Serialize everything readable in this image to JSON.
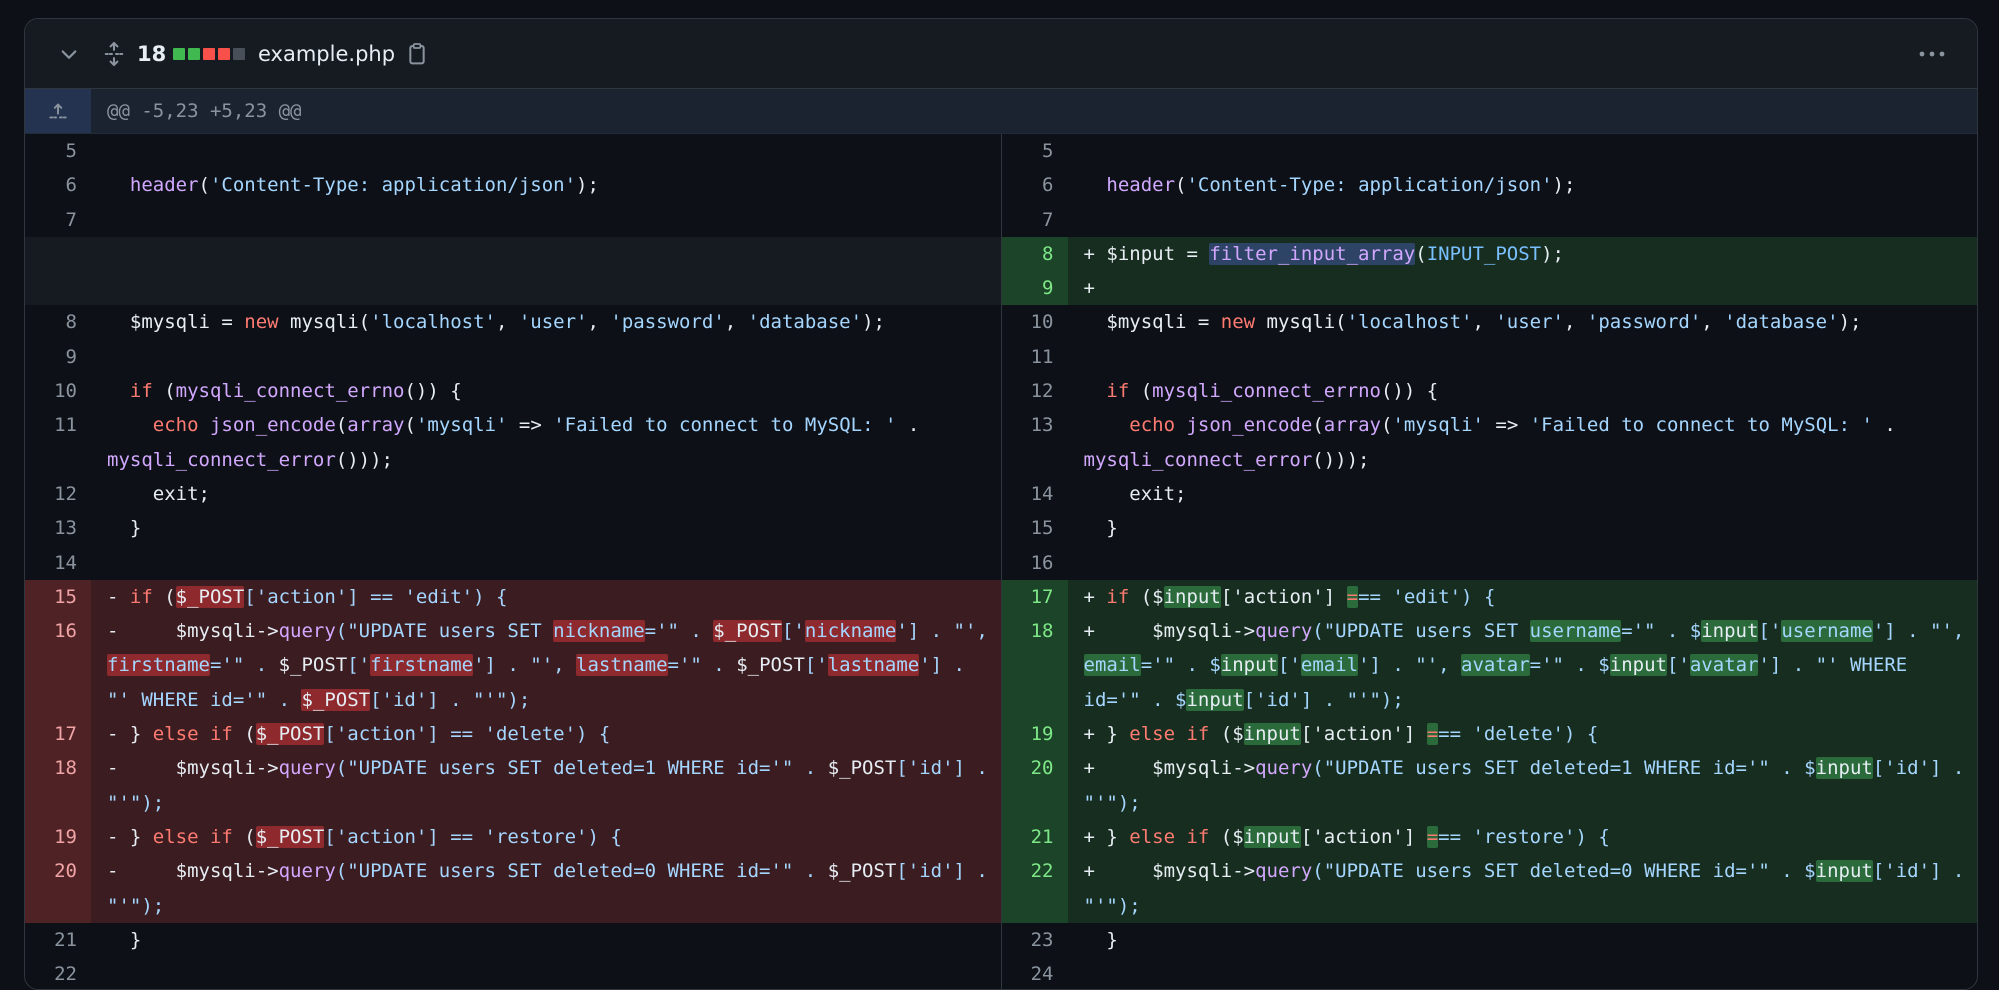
{
  "file": {
    "changes": "18",
    "name": "example.php",
    "stat_blocks": [
      "#3fb950",
      "#3fb950",
      "#f85149",
      "#f85149",
      "#484f58"
    ],
    "icons": {
      "collapse": "chevron-down-icon",
      "expand": "unfold-icon",
      "copy": "copy-icon",
      "menu": "kebab-horizontal-icon"
    }
  },
  "hunk": {
    "header": "@@ -5,23 +5,23 @@",
    "icon": "expand-up-icon"
  },
  "left_rows": [
    {
      "n": "5",
      "t": "ctx",
      "tok": []
    },
    {
      "n": "6",
      "t": "ctx",
      "tok": [
        [
          "  "
        ],
        [
          "header",
          "fn"
        ],
        [
          "("
        ],
        [
          "'Content-Type: application/json'",
          "str"
        ],
        [
          ");"
        ]
      ]
    },
    {
      "n": "7",
      "t": "ctx",
      "tok": []
    },
    {
      "n": "",
      "t": "empty",
      "tok": []
    },
    {
      "n": "",
      "t": "empty",
      "tok": []
    },
    {
      "n": "8",
      "t": "ctx",
      "tok": [
        [
          "  $mysqli = "
        ],
        [
          "new",
          "kw"
        ],
        [
          " mysqli("
        ],
        [
          "'localhost'",
          "str"
        ],
        [
          ", "
        ],
        [
          "'user'",
          "str"
        ],
        [
          ", "
        ],
        [
          "'password'",
          "str"
        ],
        [
          ", "
        ],
        [
          "'database'",
          "str"
        ],
        [
          ");"
        ]
      ]
    },
    {
      "n": "9",
      "t": "ctx",
      "tok": []
    },
    {
      "n": "10",
      "t": "ctx",
      "tok": [
        [
          "  "
        ],
        [
          "if",
          "kw"
        ],
        [
          " ("
        ],
        [
          "mysqli_connect_errno",
          "fn"
        ],
        [
          "()) {"
        ]
      ]
    },
    {
      "n": "11",
      "t": "ctx",
      "tok": [
        [
          "    "
        ],
        [
          "echo",
          "kw"
        ],
        [
          " "
        ],
        [
          "json_encode",
          "fn"
        ],
        [
          "("
        ],
        [
          "array",
          "fn"
        ],
        [
          "("
        ],
        [
          "'mysqli'",
          "str"
        ],
        [
          " => "
        ],
        [
          "'Failed to connect to MySQL: '",
          "str"
        ],
        [
          " . "
        ],
        [
          "mysqli_connect_error",
          "fn"
        ],
        [
          "()));"
        ]
      ]
    },
    {
      "n": "12",
      "t": "ctx",
      "tok": [
        [
          "    exit;"
        ]
      ]
    },
    {
      "n": "13",
      "t": "ctx",
      "tok": [
        [
          "  }"
        ]
      ]
    },
    {
      "n": "14",
      "t": "ctx",
      "tok": []
    },
    {
      "n": "15",
      "t": "del",
      "tok": [
        [
          "- "
        ],
        [
          "if",
          "kw"
        ],
        [
          " ("
        ],
        [
          "$_POST",
          "var",
          "hd"
        ],
        [
          "['action'] == 'edit') {",
          "str"
        ]
      ]
    },
    {
      "n": "16",
      "t": "del",
      "tok": [
        [
          "-     $mysqli->"
        ],
        [
          "query",
          "fn"
        ],
        [
          "(\"UPDATE users SET ",
          "str"
        ],
        [
          "nickname",
          "str",
          "hd"
        ],
        [
          "='\" . ",
          "str"
        ],
        [
          "$_POST",
          "var",
          "hd"
        ],
        [
          "['",
          "str"
        ],
        [
          "nickname",
          "str",
          "hd"
        ],
        [
          "'] . \"', ",
          "str"
        ],
        [
          "firstname",
          "str",
          "hd"
        ],
        [
          "='\" . ",
          "str"
        ],
        [
          "$_POST",
          "var"
        ],
        [
          "['",
          "str"
        ],
        [
          "firstname",
          "str",
          "hd"
        ],
        [
          "'] . \"', ",
          "str"
        ],
        [
          "lastname",
          "str",
          "hd"
        ],
        [
          "='\" . ",
          "str"
        ],
        [
          "$_POST",
          "var"
        ],
        [
          "['",
          "str"
        ],
        [
          "lastname",
          "str",
          "hd"
        ],
        [
          "'] . \"' WHERE id='\" . ",
          "str"
        ],
        [
          "$_POST",
          "var",
          "hd"
        ],
        [
          "['id'] . \"'\");",
          "str"
        ]
      ]
    },
    {
      "n": "17",
      "t": "del",
      "tok": [
        [
          "- } "
        ],
        [
          "else if",
          "kw"
        ],
        [
          " ("
        ],
        [
          "$_POST",
          "var",
          "hd"
        ],
        [
          "['action'] == 'delete') {",
          "str"
        ]
      ]
    },
    {
      "n": "18",
      "t": "del",
      "tok": [
        [
          "-     $mysqli->"
        ],
        [
          "query",
          "fn"
        ],
        [
          "(\"UPDATE users SET deleted=1 WHERE id='\" . ",
          "str"
        ],
        [
          "$_POST",
          "var"
        ],
        [
          "['id'] . \"'\");",
          "str"
        ]
      ]
    },
    {
      "n": "19",
      "t": "del",
      "tok": [
        [
          "- } "
        ],
        [
          "else if",
          "kw"
        ],
        [
          " ("
        ],
        [
          "$_POST",
          "var",
          "hd"
        ],
        [
          "['action'] == 'restore') {",
          "str"
        ]
      ]
    },
    {
      "n": "20",
      "t": "del",
      "tok": [
        [
          "-     $mysqli->"
        ],
        [
          "query",
          "fn"
        ],
        [
          "(\"UPDATE users SET deleted=0 WHERE id='\" . ",
          "str"
        ],
        [
          "$_POST",
          "var"
        ],
        [
          "['id'] . \"'\");",
          "str"
        ]
      ]
    },
    {
      "n": "21",
      "t": "ctx",
      "tok": [
        [
          "  }"
        ]
      ]
    },
    {
      "n": "22",
      "t": "ctx",
      "tok": []
    }
  ],
  "right_rows": [
    {
      "n": "5",
      "t": "ctx",
      "tok": []
    },
    {
      "n": "6",
      "t": "ctx",
      "tok": [
        [
          "  "
        ],
        [
          "header",
          "fn"
        ],
        [
          "("
        ],
        [
          "'Content-Type: application/json'",
          "str"
        ],
        [
          ");"
        ]
      ]
    },
    {
      "n": "7",
      "t": "ctx",
      "tok": []
    },
    {
      "n": "8",
      "t": "add",
      "tok": [
        [
          "+ $input = "
        ],
        [
          "filter_input_array",
          "fn",
          "hs"
        ],
        [
          "("
        ],
        [
          "INPUT_POST",
          "cst"
        ],
        [
          ");"
        ]
      ]
    },
    {
      "n": "9",
      "t": "add",
      "tok": [
        [
          "+"
        ]
      ]
    },
    {
      "n": "10",
      "t": "ctx",
      "tok": [
        [
          "  $mysqli = "
        ],
        [
          "new",
          "kw"
        ],
        [
          " mysqli("
        ],
        [
          "'localhost'",
          "str"
        ],
        [
          ", "
        ],
        [
          "'user'",
          "str"
        ],
        [
          ", "
        ],
        [
          "'password'",
          "str"
        ],
        [
          ", "
        ],
        [
          "'database'",
          "str"
        ],
        [
          ");"
        ]
      ]
    },
    {
      "n": "11",
      "t": "ctx",
      "tok": []
    },
    {
      "n": "12",
      "t": "ctx",
      "tok": [
        [
          "  "
        ],
        [
          "if",
          "kw"
        ],
        [
          " ("
        ],
        [
          "mysqli_connect_errno",
          "fn"
        ],
        [
          "()) {"
        ]
      ]
    },
    {
      "n": "13",
      "t": "ctx",
      "tok": [
        [
          "    "
        ],
        [
          "echo",
          "kw"
        ],
        [
          " "
        ],
        [
          "json_encode",
          "fn"
        ],
        [
          "("
        ],
        [
          "array",
          "fn"
        ],
        [
          "("
        ],
        [
          "'mysqli'",
          "str"
        ],
        [
          " => "
        ],
        [
          "'Failed to connect to MySQL: '",
          "str"
        ],
        [
          " . "
        ],
        [
          "mysqli_connect_error",
          "fn"
        ],
        [
          "()));"
        ]
      ]
    },
    {
      "n": "14",
      "t": "ctx",
      "tok": [
        [
          "    exit;"
        ]
      ]
    },
    {
      "n": "15",
      "t": "ctx",
      "tok": [
        [
          "  }"
        ]
      ]
    },
    {
      "n": "16",
      "t": "ctx",
      "tok": []
    },
    {
      "n": "17",
      "t": "add",
      "tok": [
        [
          "+ "
        ],
        [
          "if",
          "kw"
        ],
        [
          " ($"
        ],
        [
          "input",
          "var",
          "ha"
        ],
        [
          "['action'] "
        ],
        [
          "=",
          "kw",
          "ha"
        ],
        [
          "== 'edit') {",
          "str"
        ]
      ]
    },
    {
      "n": "18",
      "t": "add",
      "tok": [
        [
          "+     $mysqli->"
        ],
        [
          "query",
          "fn"
        ],
        [
          "(\"UPDATE users SET ",
          "str"
        ],
        [
          "username",
          "str",
          "ha"
        ],
        [
          "='\" . $",
          "str"
        ],
        [
          "input",
          "var",
          "ha"
        ],
        [
          "['",
          "str"
        ],
        [
          "username",
          "str",
          "ha"
        ],
        [
          "'] . \"', ",
          "str"
        ],
        [
          "email",
          "str",
          "ha"
        ],
        [
          "='\" . $",
          "str"
        ],
        [
          "input",
          "var",
          "ha"
        ],
        [
          "['",
          "str"
        ],
        [
          "email",
          "str",
          "ha"
        ],
        [
          "'] . \"', ",
          "str"
        ],
        [
          "avatar",
          "str",
          "ha"
        ],
        [
          "='\" . $",
          "str"
        ],
        [
          "input",
          "var",
          "ha"
        ],
        [
          "['",
          "str"
        ],
        [
          "avatar",
          "str",
          "ha"
        ],
        [
          "'] . \"' WHERE id='\" . $",
          "str"
        ],
        [
          "input",
          "var",
          "ha"
        ],
        [
          "['id'] . \"'\");",
          "str"
        ]
      ]
    },
    {
      "n": "19",
      "t": "add",
      "tok": [
        [
          "+ } "
        ],
        [
          "else if",
          "kw"
        ],
        [
          " ($"
        ],
        [
          "input",
          "var",
          "ha"
        ],
        [
          "['action'] "
        ],
        [
          "=",
          "kw",
          "ha"
        ],
        [
          "== 'delete') {",
          "str"
        ]
      ]
    },
    {
      "n": "20",
      "t": "add",
      "tok": [
        [
          "+     $mysqli->"
        ],
        [
          "query",
          "fn"
        ],
        [
          "(\"UPDATE users SET deleted=1 WHERE id='\" . $",
          "str"
        ],
        [
          "input",
          "var",
          "ha"
        ],
        [
          "['id'] . \"'\");",
          "str"
        ]
      ]
    },
    {
      "n": "21",
      "t": "add",
      "tok": [
        [
          "+ } "
        ],
        [
          "else if",
          "kw"
        ],
        [
          " ($"
        ],
        [
          "input",
          "var",
          "ha"
        ],
        [
          "['action'] "
        ],
        [
          "=",
          "kw",
          "ha"
        ],
        [
          "== 'restore') {",
          "str"
        ]
      ]
    },
    {
      "n": "22",
      "t": "add",
      "tok": [
        [
          "+     $mysqli->"
        ],
        [
          "query",
          "fn"
        ],
        [
          "(\"UPDATE users SET deleted=0 WHERE id='\" . $",
          "str"
        ],
        [
          "input",
          "var",
          "ha"
        ],
        [
          "['id'] . \"'\");",
          "str"
        ]
      ]
    },
    {
      "n": "23",
      "t": "ctx",
      "tok": [
        [
          "  }"
        ]
      ]
    },
    {
      "n": "24",
      "t": "ctx",
      "tok": []
    }
  ]
}
